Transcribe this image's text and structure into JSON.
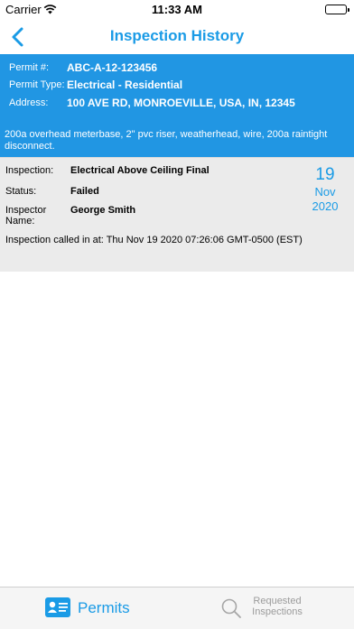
{
  "status_bar": {
    "carrier": "Carrier",
    "time": "11:33 AM"
  },
  "nav": {
    "title": "Inspection History"
  },
  "permit": {
    "number_label": "Permit #:",
    "number_value": "ABC-A-12-123456",
    "type_label": "Permit Type:",
    "type_value": "Electrical - Residential",
    "address_label": "Address:",
    "address_value": "100 AVE RD, MONROEVILLE, USA, IN, 12345",
    "description": "200a overhead meterbase, 2\" pvc riser, weatherhead, wire, 200a raintight disconnect."
  },
  "inspection": {
    "inspection_label": "Inspection:",
    "inspection_value": "Electrical Above Ceiling Final",
    "status_label": "Status:",
    "status_value": "Failed",
    "inspector_label": "Inspector Name:",
    "inspector_value": "George Smith",
    "called_in": "Inspection called in at: Thu Nov 19 2020 07:26:06 GMT-0500 (EST)",
    "date_day": "19",
    "date_month": "Nov",
    "date_year": "2020"
  },
  "tabbar": {
    "permits_label": "Permits",
    "requested_label": "Requested Inspections"
  },
  "colors": {
    "accent": "#1a9be6",
    "header_blue": "#2196e3",
    "battery_green": "#4cd964"
  },
  "icons": [
    "wifi-icon",
    "battery-icon",
    "back-chevron-icon",
    "permit-card-icon",
    "search-icon"
  ]
}
